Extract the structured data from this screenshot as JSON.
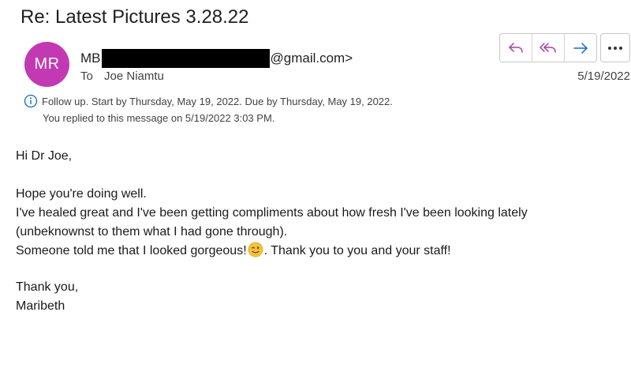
{
  "email": {
    "subject": "Re: Latest Pictures 3.28.22",
    "sender": {
      "initials": "MR",
      "name_prefix": "MB",
      "email_suffix": "@gmail.com>",
      "avatar_color": "#c239b3"
    },
    "to_label": "To",
    "to_name": "Joe Niamtu",
    "date": "5/19/2022",
    "actions": {
      "reply_icon": "reply-icon",
      "reply_all_icon": "reply-all-icon",
      "forward_icon": "forward-icon",
      "more_icon": "more-options-icon",
      "accent_color": "#a33fa3",
      "forward_color": "#0f6cbd"
    },
    "followup": {
      "icon": "info-icon",
      "text": "Follow up.  Start by Thursday, May 19, 2022.  Due by Thursday, May 19, 2022.",
      "replied": "You replied to this message on 5/19/2022 3:03 PM."
    },
    "body": {
      "greeting": "Hi Dr Joe,",
      "line1": "Hope you're doing well.",
      "line2": "I've healed great and I've been getting compliments about how fresh I've been looking lately",
      "line3": "(unbeknownst to them what I had gone through).",
      "line4_before": "Someone told me that I looked gorgeous!",
      "line4_emoji": "winking-face-emoji",
      "line4_after": ". Thank you to you and your staff!",
      "closing": "Thank you,",
      "signature": "Maribeth"
    }
  }
}
